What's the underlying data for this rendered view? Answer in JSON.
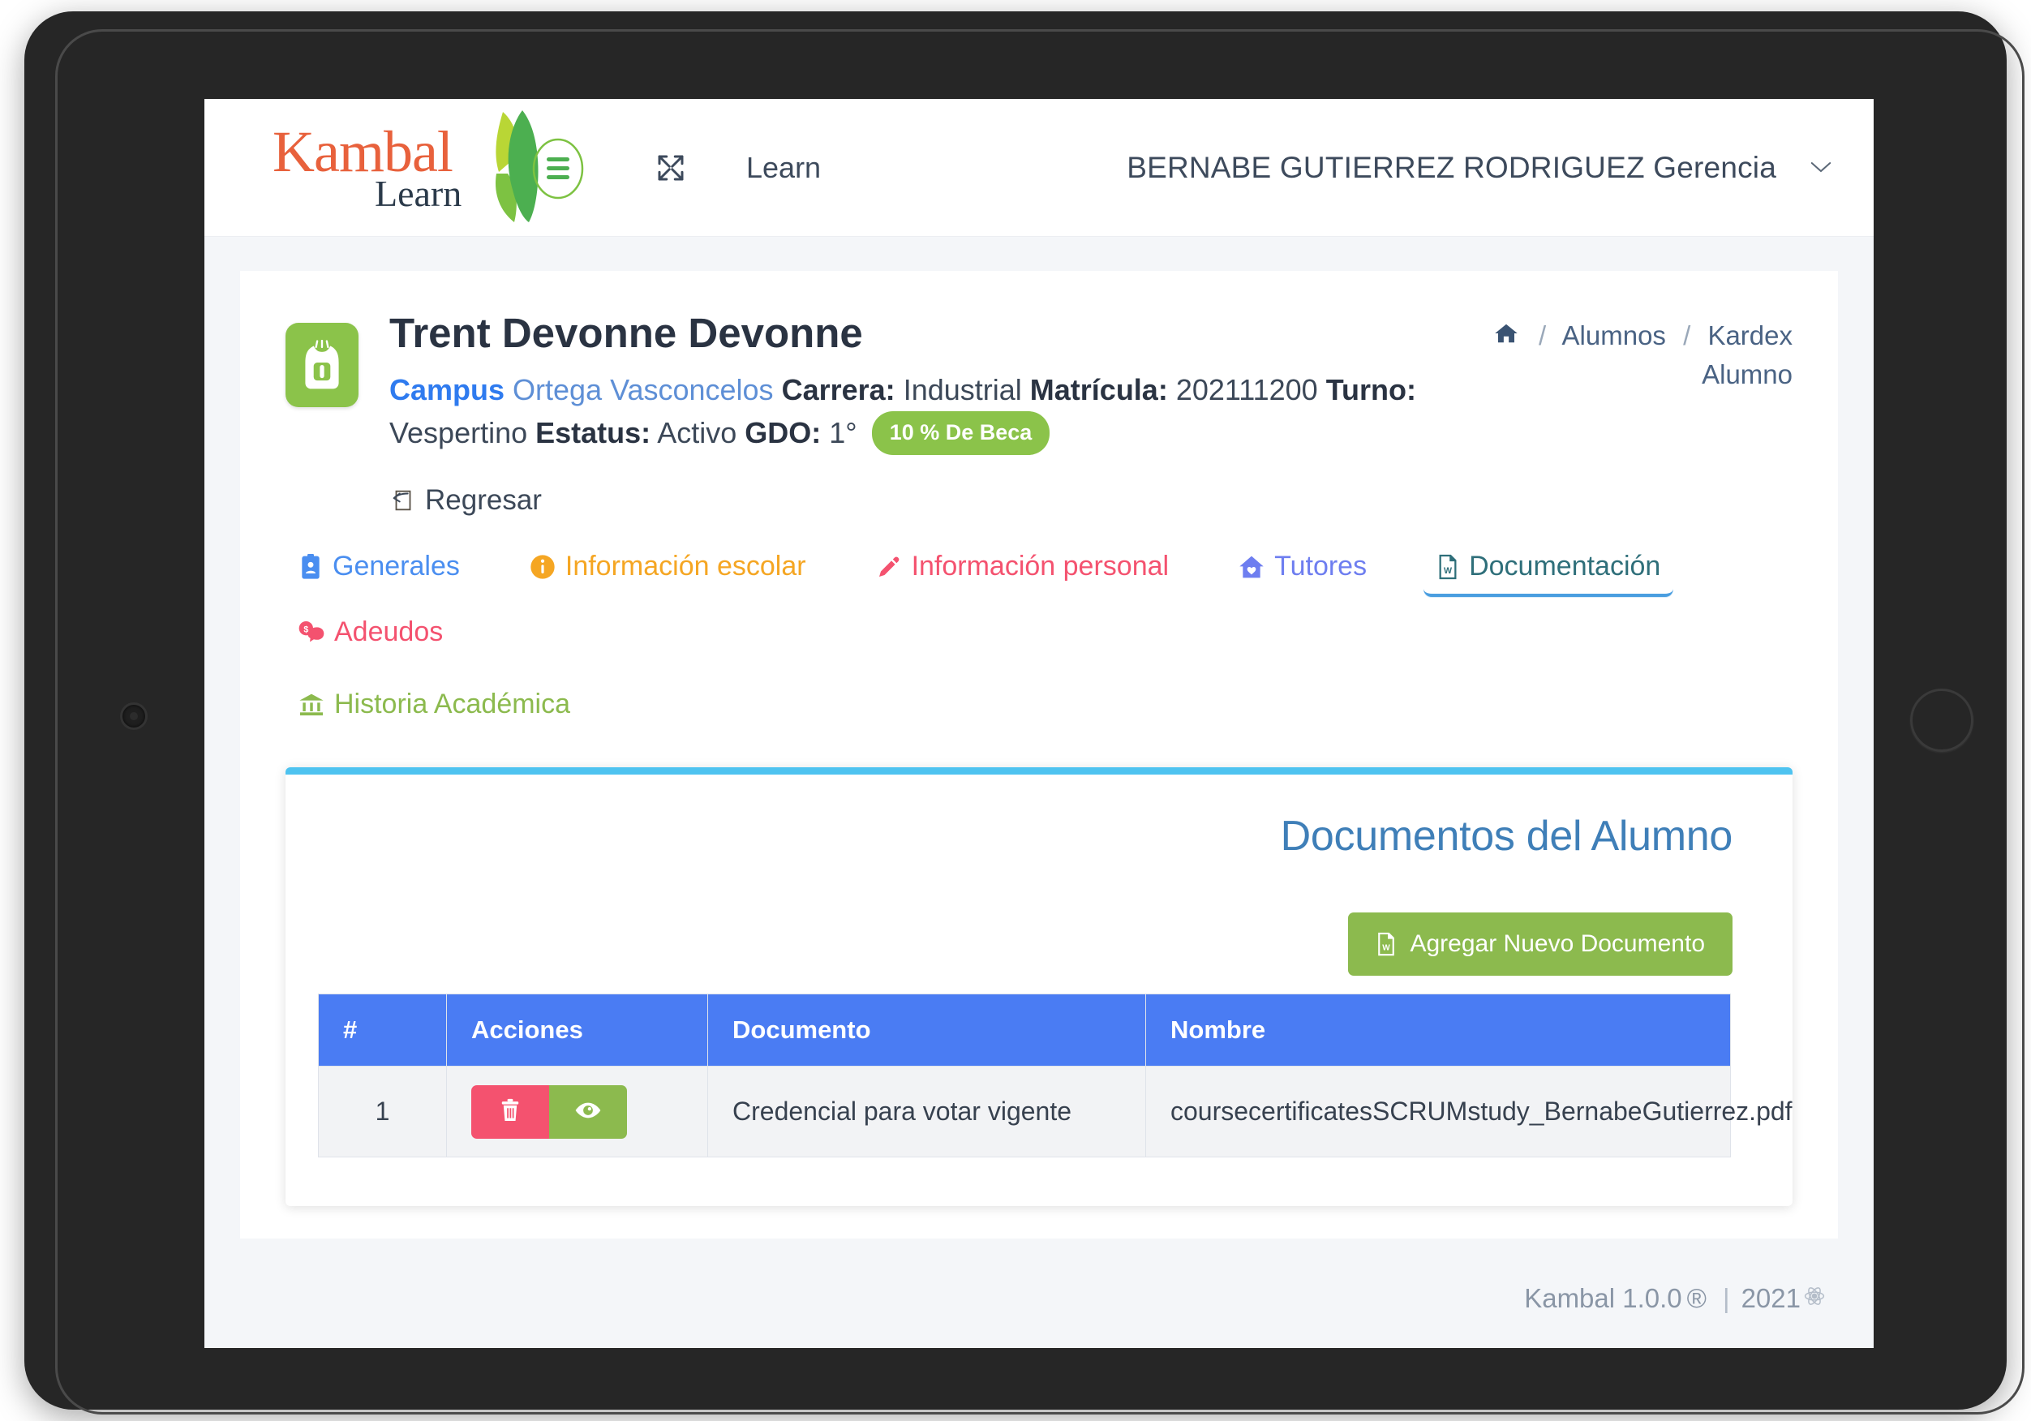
{
  "navbar": {
    "brand_word": "Kambal",
    "brand_sub": "Learn",
    "expand_icon": "expand-arrows-icon",
    "menu_icon": "hamburger-menu-icon",
    "learn_label": "Learn",
    "user_label": "BERNABE GUTIERREZ RODRIGUEZ Gerencia",
    "chevron": "⌄"
  },
  "student": {
    "avatar_icon": "backpack-icon",
    "name": "Trent Devonne Devonne",
    "campus_label": "Campus",
    "campus_value": "Ortega Vasconcelos",
    "carrera_label": "Carrera:",
    "carrera_value": "Industrial",
    "matricula_label": "Matrícula:",
    "matricula_value": "202111200",
    "turno_label": "Turno:",
    "turno_value": "Vespertino",
    "estatus_label": "Estatus:",
    "estatus_value": "Activo",
    "gdo_label": "GDO:",
    "gdo_value": "1°",
    "beca_badge": "10 % De Beca",
    "back_link": "Regresar",
    "back_icon": "back-arrow-page-icon"
  },
  "breadcrumb": {
    "home_icon": "home-icon",
    "sep": "/",
    "item1": "Alumnos",
    "item2": "Kardex Alumno"
  },
  "tabs": [
    {
      "label": "Generales",
      "icon": "id-card-icon",
      "color": "#4a8ef0",
      "active": false
    },
    {
      "label": "Información escolar",
      "icon": "info-circle-icon",
      "color": "#f5a623",
      "active": false
    },
    {
      "label": "Información personal",
      "icon": "pencil-icon",
      "color": "#f4526f",
      "active": false
    },
    {
      "label": "Tutores",
      "icon": "home-heart-icon",
      "color": "#6e7ef0",
      "active": false
    },
    {
      "label": "Documentación",
      "icon": "word-file-icon",
      "color": "#2f6f7a",
      "active": true
    },
    {
      "label": "Adeudos",
      "icon": "money-comment-icon",
      "color": "#f4526f",
      "active": false
    },
    {
      "label": "Historia Académica",
      "icon": "university-icon",
      "color": "#8cba4e",
      "active": false
    }
  ],
  "documents_panel": {
    "title": "Documentos del Alumno",
    "add_button": "Agregar Nuevo Documento",
    "add_button_icon": "word-file-icon",
    "accent_color": "#4ec3f0",
    "columns": [
      "#",
      "Acciones",
      "Documento",
      "Nombre"
    ],
    "rows": [
      {
        "num": "1",
        "delete_icon": "trash-icon",
        "view_icon": "eye-icon",
        "documento": "Credencial para votar vigente",
        "nombre": "coursecertificatesSCRUMstudy_BernabeGutierrez.pdf"
      }
    ]
  },
  "footer": {
    "app": "Kambal 1.0.0",
    "registered": "®",
    "pipe": "|",
    "year": "2021",
    "icon": "atom-icon"
  }
}
